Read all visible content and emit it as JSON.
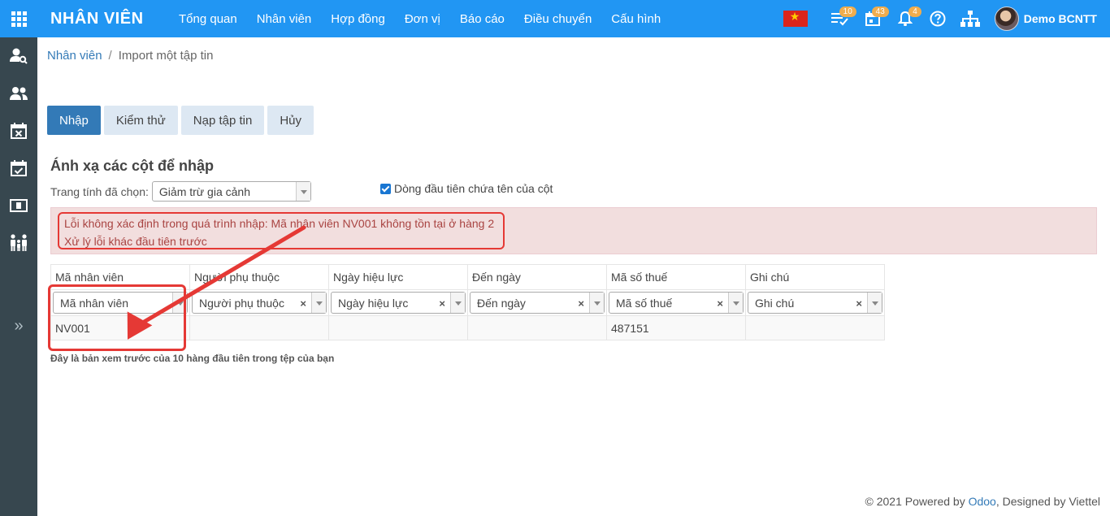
{
  "app": {
    "title": "NHÂN VIÊN"
  },
  "menu": [
    "Tổng quan",
    "Nhân viên",
    "Hợp đồng",
    "Đơn vị",
    "Báo cáo",
    "Điều chuyển",
    "Cấu hình"
  ],
  "topbar": {
    "activities_count": "10",
    "calendar_count": "43",
    "notifications_count": "4",
    "user_name": "Demo BCNTT",
    "flag_color": "#da251d",
    "badge_color": "#f0ad4e"
  },
  "sidebar": {
    "items": [
      "user-search-icon",
      "users-icon",
      "calendar-x-icon",
      "calendar-check-icon",
      "money-icon",
      "family-icon"
    ],
    "expand": "»"
  },
  "breadcrumb": {
    "parent": "Nhân viên",
    "current": "Import một tập tin"
  },
  "actions": {
    "import": "Nhập",
    "test": "Kiểm thử",
    "reload": "Nạp tập tin",
    "cancel": "Hủy"
  },
  "mapping": {
    "title": "Ánh xạ các cột để nhập",
    "sheet_label": "Trang tính đã chọn:",
    "sheet_value": "Giảm trừ gia cảnh",
    "header_checkbox_label": "Dòng đầu tiên chứa tên của cột",
    "header_checkbox_checked": true
  },
  "alert": {
    "line1": "Lỗi không xác định trong quá trình nhập: Mã nhân viên NV001 không tồn tại ở hàng 2",
    "line2": "Xử lý lỗi khác đầu tiên trước"
  },
  "table": {
    "headers": [
      "Mã nhân viên",
      "Người phụ thuộc",
      "Ngày hiệu lực",
      "Đến ngày",
      "Mã số thuế",
      "Ghi chú"
    ],
    "fields": [
      "Mã nhân viên",
      "Người phụ thuộc",
      "Ngày hiệu lực",
      "Đến ngày",
      "Mã số thuế",
      "Ghi chú"
    ],
    "clear_glyph": "×",
    "rows": [
      [
        "NV001",
        "",
        "",
        "",
        "487151",
        ""
      ]
    ]
  },
  "preview_note": "Đây là bản xem trước của 10 hàng đầu tiên trong tệp của bạn",
  "footer": {
    "prefix": "© 2021 Powered by ",
    "odoo": "Odoo",
    "suffix": ", Designed by Viettel"
  },
  "colors": {
    "topbar": "#2196f3",
    "sidebar": "#37474f",
    "primary": "#337ab7",
    "alert_bg": "#f2dede",
    "annotation": "#e53935"
  }
}
